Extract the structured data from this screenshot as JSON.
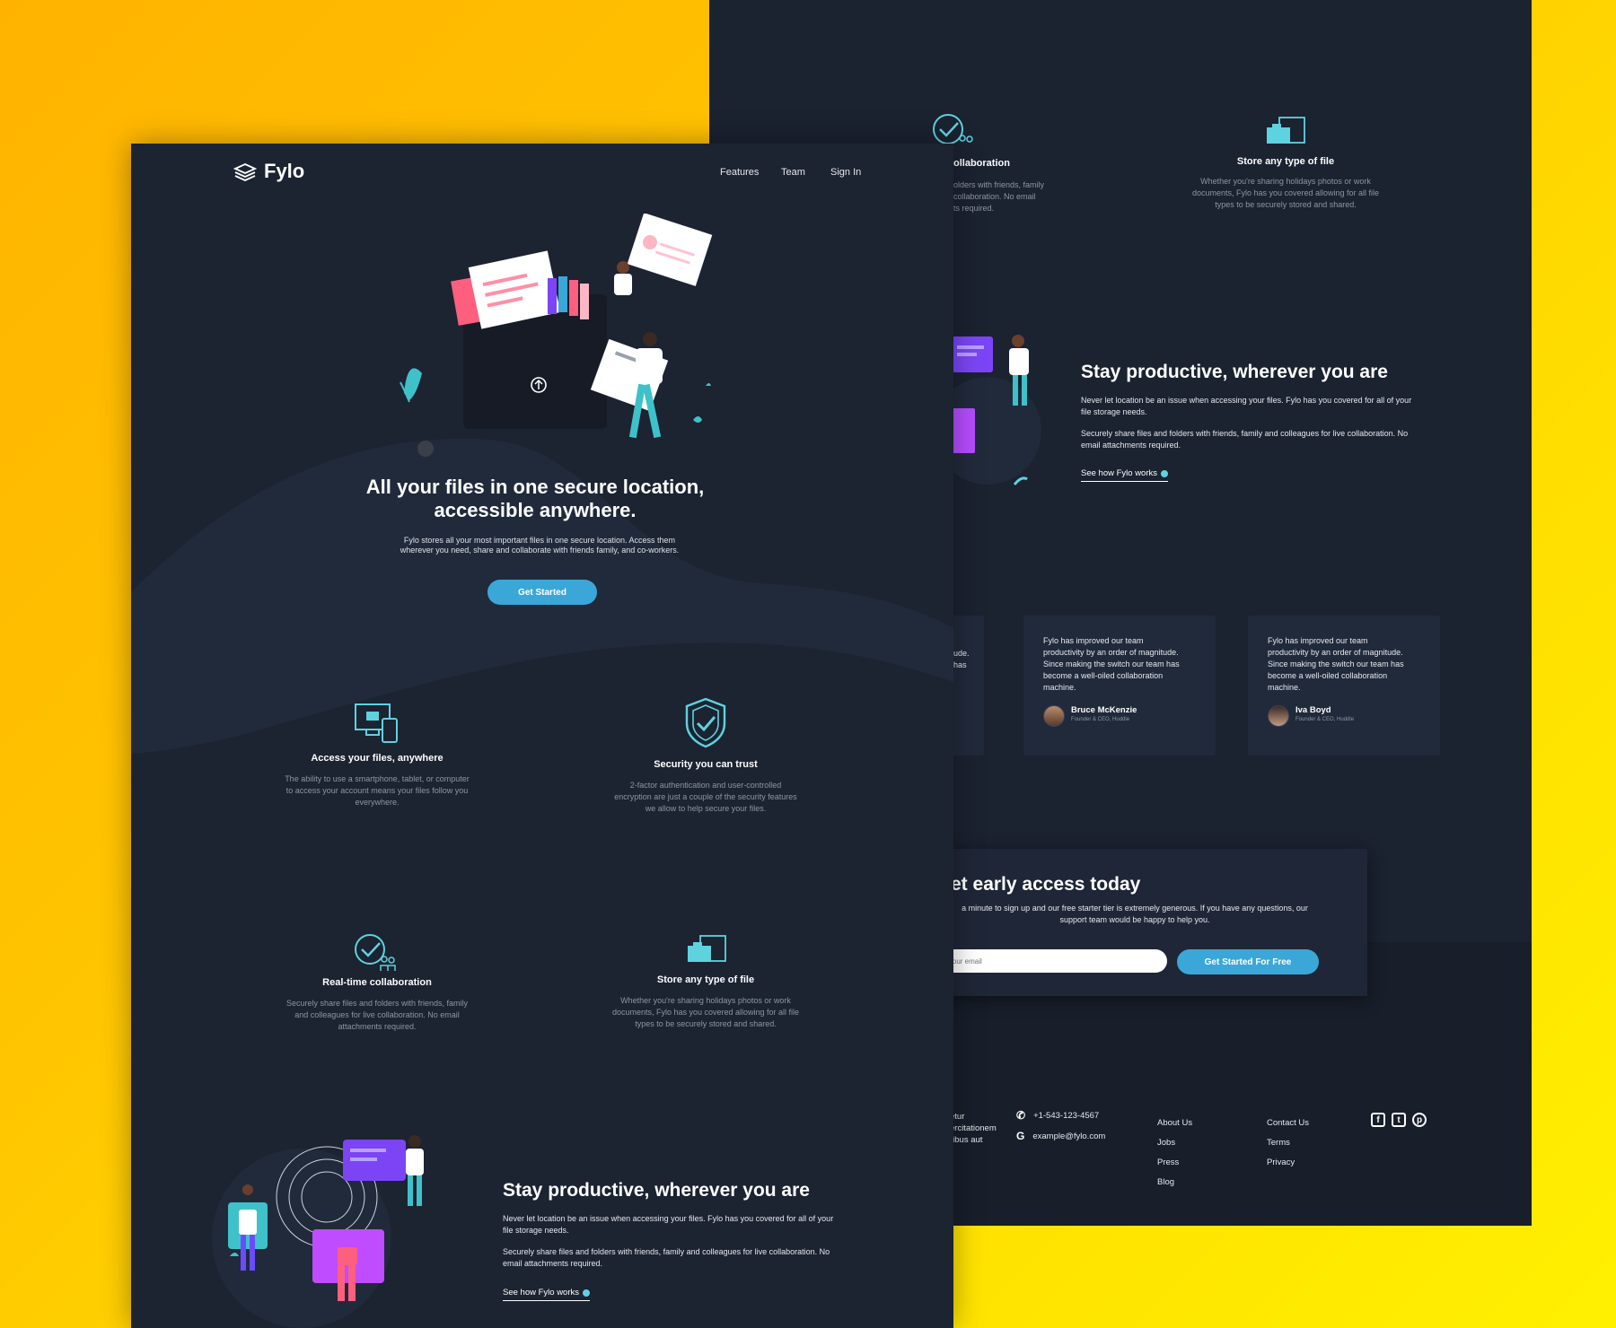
{
  "brand": {
    "name": "Fylo"
  },
  "nav": {
    "features": "Features",
    "team": "Team",
    "signin": "Sign In"
  },
  "hero": {
    "title_line1": "All your files in one secure location,",
    "title_line2": "accessible anywhere.",
    "text_line1": "Fylo stores all your most important files in one secure location. Access them",
    "text_line2": "wherever you need, share and collaborate with friends family, and co-workers.",
    "cta": "Get Started"
  },
  "features": [
    {
      "title": "Access your files, anywhere",
      "l1": "The ability to use a smartphone, tablet, or computer",
      "l2": "to access your account means your files follow you",
      "l3": "everywhere."
    },
    {
      "title": "Security you can trust",
      "l1": "2-factor authentication and user-controlled",
      "l2": "encryption are just a couple of the security features",
      "l3": "we allow to help secure your files."
    },
    {
      "title": "Real-time collaboration",
      "l1": "Securely share files and folders with friends, family",
      "l2": "and colleagues for live collaboration. No email",
      "l3": "attachments required."
    },
    {
      "title": "Store any type of file",
      "l1": "Whether you're sharing holidays photos or work",
      "l2": "documents, Fylo has you covered allowing for all file",
      "l3": "types to be securely stored and shared."
    }
  ],
  "right_features": {
    "collab_title": "ollaboration",
    "collab_l1": "olders with friends, family",
    "collab_l2": "collaboration. No email",
    "collab_l3": "ts required.",
    "store_title": "Store any type of file",
    "store_l1": "Whether you're sharing holidays photos or work",
    "store_l2": "documents, Fylo has you covered allowing for all file",
    "store_l3": "types to be securely stored and shared."
  },
  "productive": {
    "title": "Stay productive, wherever you are",
    "p1_l1": "Never let location be an issue when accessing your files. Fylo has you covered for all of your",
    "p1_l2": "file storage needs.",
    "p2_l1": "Securely share files and folders with friends, family and colleagues for live collaboration. No",
    "p2_l2": "email attachments required.",
    "link": "See how Fylo works"
  },
  "testimonials": {
    "partial_l1": "ude.",
    "partial_l2": "has",
    "quote_l1": "Fylo has improved our team",
    "quote_l2": "productivity by an order of magnitude.",
    "quote_l3": "Since making the switch our team has",
    "quote_l4": "become a well-oiled collaboration",
    "quote_l5": "machine.",
    "items": [
      {
        "name": "Bruce McKenzie",
        "role": "Founder & CEO, Huddle"
      },
      {
        "name": "Iva Boyd",
        "role": "Founder & CEO, Huddle"
      }
    ]
  },
  "cta": {
    "title": "Get early access today",
    "l1": "a minute to sign up and our free starter tier is extremely generous. If you have any questions, our",
    "l2": "support team would be happy to help you.",
    "email_placeholder": "r your email",
    "button": "Get Started For Free"
  },
  "footer": {
    "partial_l1": "etur",
    "partial_l2": "ercitationem",
    "partial_l3": "ribus aut",
    "phone": "+1-543-123-4567",
    "email": "example@fylo.com",
    "col1": [
      "About Us",
      "Jobs",
      "Press",
      "Blog"
    ],
    "col2": [
      "Contact Us",
      "Terms",
      "Privacy"
    ],
    "social": [
      "facebook-icon",
      "twitter-icon",
      "pinterest-icon"
    ]
  },
  "colors": {
    "background_gradient": [
      "#ffb300",
      "#fff000"
    ],
    "panel": "#1c2331",
    "accent": "#3ba7d8",
    "teal": "#5fd2e0"
  }
}
